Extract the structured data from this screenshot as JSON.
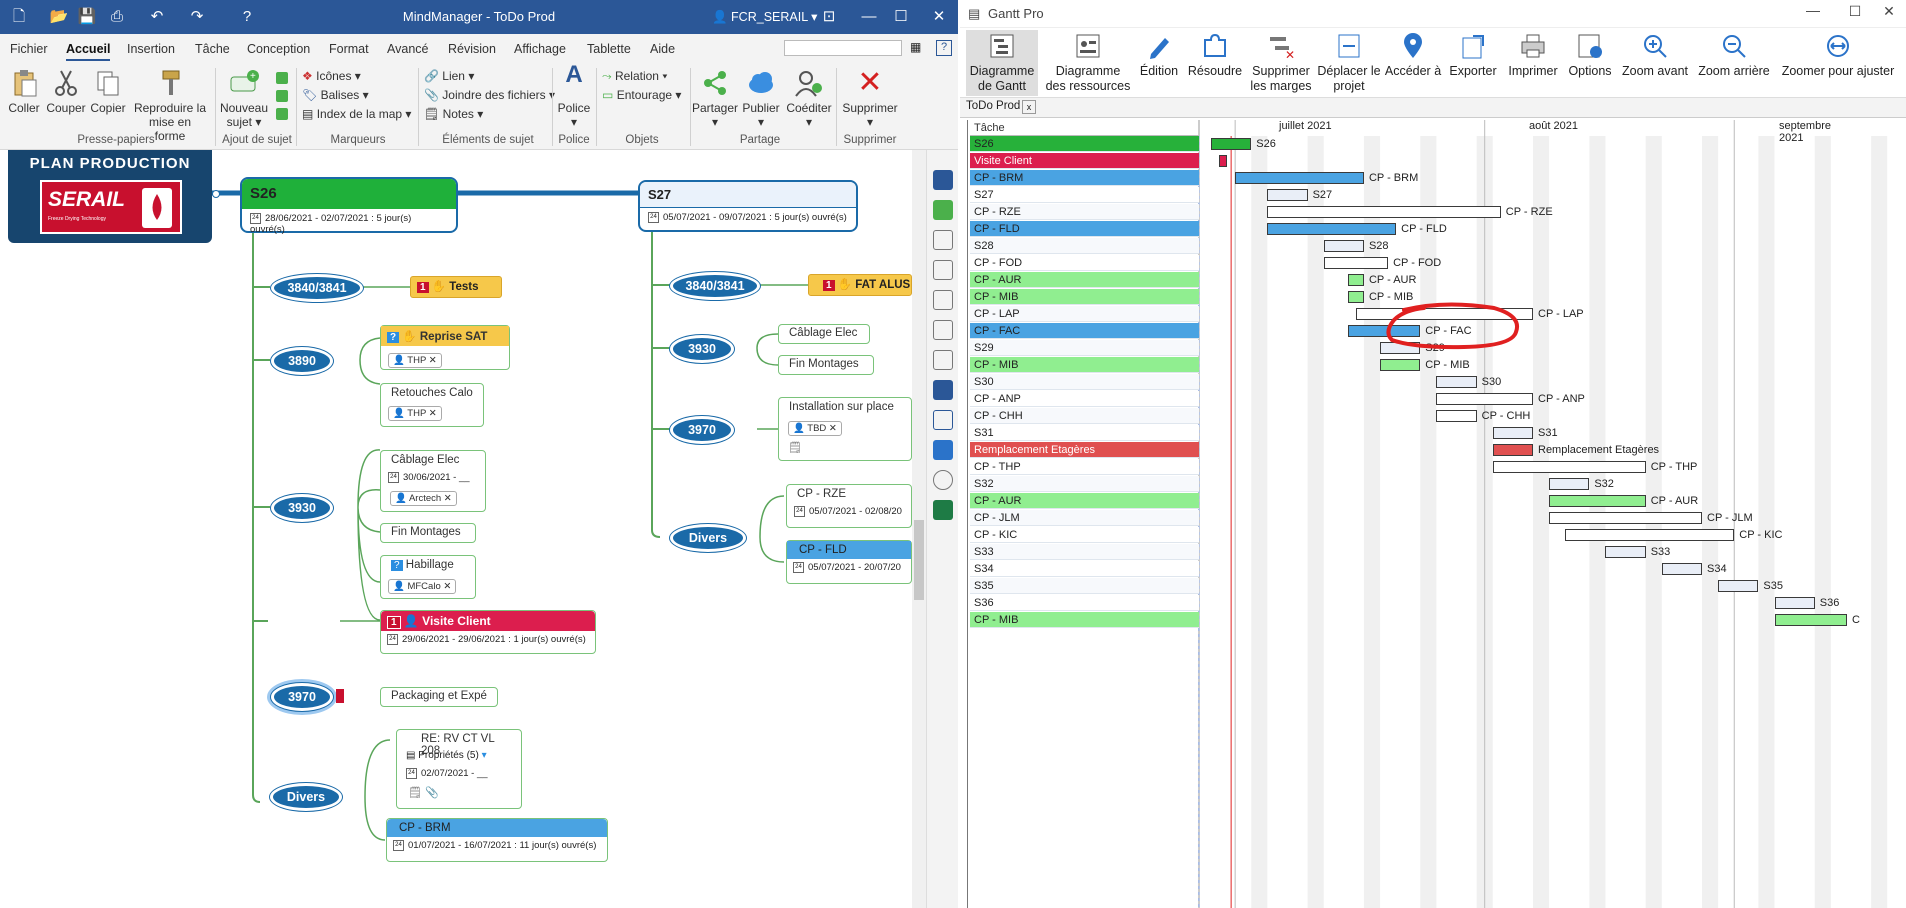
{
  "mm": {
    "title": "MindManager - ToDo Prod",
    "user": "FCR_SERAIL",
    "menu": [
      "Fichier",
      "Accueil",
      "Insertion",
      "Tâche",
      "Conception",
      "Format",
      "Avancé",
      "Révision",
      "Affichage",
      "Tablette",
      "Aide"
    ],
    "ribbon": {
      "coller": "Coller",
      "couper": "Couper",
      "copier": "Copier",
      "reproduire1": "Reproduire la",
      "reproduire2": "mise en forme",
      "nouveau1": "Nouveau",
      "nouveau2": "sujet",
      "icones": "Icônes",
      "balises": "Balises",
      "index": "Index de la map",
      "lien": "Lien",
      "joindre": "Joindre des fichiers",
      "notes": "Notes",
      "police": "Police",
      "relation": "Relation",
      "entourage": "Entourage",
      "partager": "Partager",
      "publier": "Publier",
      "coediter": "Coéditer",
      "supprimer": "Supprimer",
      "groups": [
        "Presse-papiers",
        "Ajout de sujet",
        "Marqueurs",
        "Éléments de sujet",
        "Police",
        "Objets",
        "Partage",
        "Supprimer"
      ]
    },
    "map": {
      "plan_title": "PLAN PRODUCTION",
      "logo": "SERAIL",
      "logo_sub": "Freeze Drying Technology",
      "s26": {
        "title": "S26",
        "dates": "28/06/2021 - 02/07/2021 : 5 jour(s) ouvré(s)"
      },
      "s27": {
        "title": "S27",
        "dates": "05/07/2021 - 09/07/2021 : 5 jour(s) ouvré(s)"
      },
      "b1": "3840/3841",
      "b2": "3890",
      "b3": "3930",
      "b4": "3970",
      "b5": "Divers",
      "tests": "Tests",
      "reprise": "Reprise SAT",
      "thp": "THP",
      "retouches": "Retouches Calo",
      "thp2": "THP",
      "cablage": "Câblage Elec",
      "cablage_date": "30/06/2021 - __",
      "arctech": "Arctech",
      "fin_montages": "Fin Montages",
      "habillage": "Habillage",
      "mfcalo": "MFCalo",
      "visite": "Visite Client",
      "visite_dates": "29/06/2021 - 29/06/2021 : 1 jour(s) ouvré(s)",
      "packaging": "Packaging et Expé",
      "rerv": "RE: RV CT VL 208",
      "props": "Propriétés (5)",
      "rerv_date": "02/07/2021 - __",
      "cpbrm": "CP - BRM",
      "cpbrm_dates": "01/07/2021 - 16/07/2021 : 11 jour(s) ouvré(s)",
      "r_b1": "3840/3841",
      "fat": "FAT ALUS",
      "r_b2": "3930",
      "r_cablage": "Câblage Elec",
      "r_fin": "Fin Montages",
      "r_b3": "3970",
      "install": "Installation sur place",
      "tbd": "TBD",
      "r_b4": "Divers",
      "cprze": "CP - RZE",
      "cprze_date": "05/07/2021 - 02/08/20",
      "cpfld": "CP - FLD",
      "cpfld_date": "05/07/2021 - 20/07/20"
    }
  },
  "gantt": {
    "title": "Gantt Pro",
    "toolbar": [
      "Diagramme de Gantt",
      "Diagramme des ressources",
      "Édition",
      "Résoudre",
      "Supprimer les marges",
      "Déplacer le projet",
      "Accéder à",
      "Exporter",
      "Imprimer",
      "Options",
      "Zoom avant",
      "Zoom arrière",
      "Zoomer pour ajuster"
    ],
    "tab": "ToDo Prod",
    "col_header": "Tâche",
    "months": [
      "juillet 2021",
      "août 2021",
      "septembre 2021"
    ],
    "tasks": [
      {
        "name": "S26",
        "label": "S26",
        "start": 0,
        "dur": 5,
        "color": "#27b13a"
      },
      {
        "name": "Visite Client",
        "label": "",
        "start": 1,
        "dur": 1,
        "color": "#dc1e4e"
      },
      {
        "name": "CP - BRM",
        "label": "CP - BRM",
        "start": 3,
        "dur": 16,
        "color": "#4aa3e2"
      },
      {
        "name": "S27",
        "label": "S27",
        "start": 7,
        "dur": 5,
        "color": "#e9eef7"
      },
      {
        "name": "CP - RZE",
        "label": "CP - RZE",
        "start": 7,
        "dur": 29,
        "color": "#ffffff"
      },
      {
        "name": "CP - FLD",
        "label": "CP - FLD",
        "start": 7,
        "dur": 16,
        "color": "#4aa3e2"
      },
      {
        "name": "S28",
        "label": "S28",
        "start": 14,
        "dur": 5,
        "color": "#e9eef7"
      },
      {
        "name": "CP - FOD",
        "label": "CP - FOD",
        "start": 14,
        "dur": 8,
        "color": "#ffffff"
      },
      {
        "name": "CP - AUR",
        "label": "CP - AUR",
        "start": 17,
        "dur": 2,
        "color": "#90ee90"
      },
      {
        "name": "CP - MIB",
        "label": "CP - MIB",
        "start": 17,
        "dur": 2,
        "color": "#90ee90"
      },
      {
        "name": "CP - LAP",
        "label": "CP - LAP",
        "start": 18,
        "dur": 22,
        "color": "#ffffff"
      },
      {
        "name": "CP - FAC",
        "label": "CP - FAC",
        "start": 17,
        "dur": 9,
        "color": "#4aa3e2"
      },
      {
        "name": "S29",
        "label": "S29",
        "start": 21,
        "dur": 5,
        "color": "#e9eef7"
      },
      {
        "name": "CP - MIB",
        "label": "CP - MIB",
        "start": 21,
        "dur": 5,
        "color": "#90ee90"
      },
      {
        "name": "S30",
        "label": "S30",
        "start": 28,
        "dur": 5,
        "color": "#e9eef7"
      },
      {
        "name": "CP - ANP",
        "label": "CP - ANP",
        "start": 28,
        "dur": 12,
        "color": "#ffffff"
      },
      {
        "name": "CP - CHH",
        "label": "CP - CHH",
        "start": 28,
        "dur": 5,
        "color": "#ffffff"
      },
      {
        "name": "S31",
        "label": "S31",
        "start": 35,
        "dur": 5,
        "color": "#e9eef7"
      },
      {
        "name": "Remplacement Etagères",
        "label": "Remplacement Etagères",
        "start": 35,
        "dur": 5,
        "color": "#e05050"
      },
      {
        "name": "CP - THP",
        "label": "CP - THP",
        "start": 35,
        "dur": 19,
        "color": "#ffffff"
      },
      {
        "name": "S32",
        "label": "S32",
        "start": 42,
        "dur": 5,
        "color": "#e9eef7"
      },
      {
        "name": "CP - AUR",
        "label": "CP - AUR",
        "start": 42,
        "dur": 12,
        "color": "#90ee90"
      },
      {
        "name": "CP - JLM",
        "label": "CP - JLM",
        "start": 42,
        "dur": 19,
        "color": "#ffffff"
      },
      {
        "name": "CP - KIC",
        "label": "CP - KIC",
        "start": 44,
        "dur": 21,
        "color": "#ffffff"
      },
      {
        "name": "S33",
        "label": "S33",
        "start": 49,
        "dur": 5,
        "color": "#e9eef7"
      },
      {
        "name": "S34",
        "label": "S34",
        "start": 56,
        "dur": 5,
        "color": "#e9eef7"
      },
      {
        "name": "S35",
        "label": "S35",
        "start": 63,
        "dur": 5,
        "color": "#e9eef7"
      },
      {
        "name": "S36",
        "label": "S36",
        "start": 70,
        "dur": 5,
        "color": "#e9eef7"
      },
      {
        "name": "CP - MIB",
        "label": "C",
        "start": 70,
        "dur": 9,
        "color": "#90ee90"
      }
    ]
  }
}
